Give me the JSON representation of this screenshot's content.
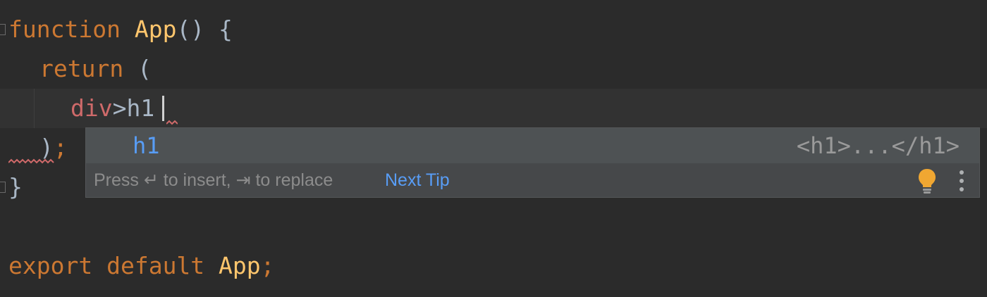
{
  "code": {
    "line1": {
      "kw": "function",
      "name": "App",
      "rest": "() {"
    },
    "line2": {
      "kw": "return",
      "rest": "("
    },
    "line3": {
      "tag": "div",
      "op": ">",
      "typed": "h1"
    },
    "line4": {
      "paren": ")",
      "semi": ";"
    },
    "line5": {
      "brace": "}"
    },
    "line7": {
      "kw1": "export",
      "kw2": "default",
      "name": "App",
      "semi": ";"
    }
  },
  "completion": {
    "item_label": "h1",
    "item_preview": "<h1>...</h1>",
    "hint": "Press ↵ to insert, ⇥ to replace",
    "next_tip": "Next Tip"
  },
  "icons": {
    "bulb": "lightbulb-icon",
    "more": "more-vertical-icon"
  },
  "colors": {
    "background": "#2b2b2b",
    "keyword": "#cc7832",
    "function_name": "#ffc66d",
    "error_tag": "#cf6a6a",
    "completion_accent": "#589df6",
    "bulb": "#f0a732"
  }
}
